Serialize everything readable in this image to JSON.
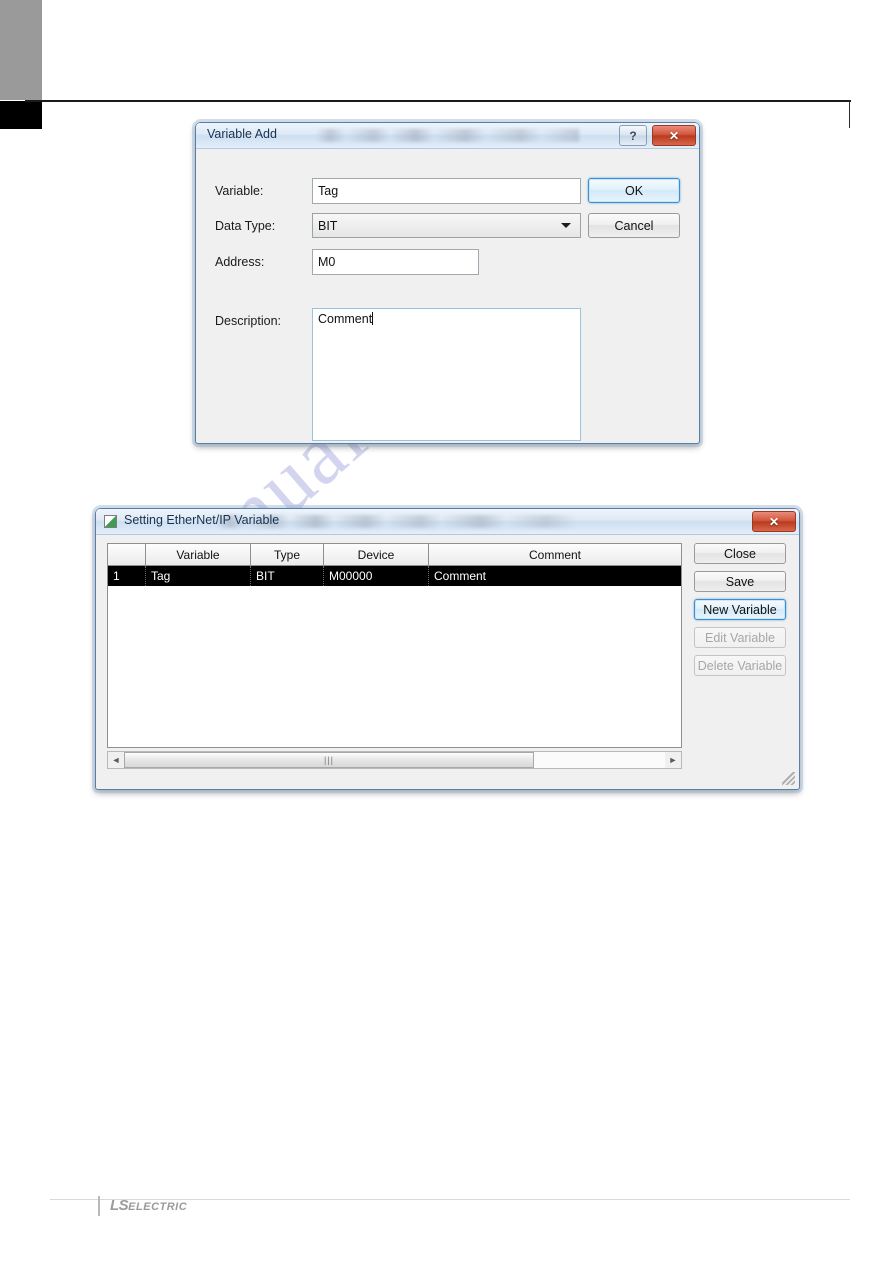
{
  "page": {
    "footer_logo_main": "LS",
    "footer_logo_sub": "ELECTRIC",
    "watermark": "manualshive.com"
  },
  "variable_add_dialog": {
    "title": "Variable Add",
    "help_button": "?",
    "close_button": "✕",
    "fields": {
      "variable_label": "Variable:",
      "variable_value": "Tag",
      "data_type_label": "Data Type:",
      "data_type_value": "BIT",
      "address_label": "Address:",
      "address_value": "M0",
      "description_label": "Description:",
      "description_value": "Comment"
    },
    "buttons": {
      "ok": "OK",
      "cancel": "Cancel"
    }
  },
  "setting_dialog": {
    "title": "Setting EtherNet/IP Variable",
    "close_button": "✕",
    "grid": {
      "columns": [
        "",
        "Variable",
        "Type",
        "Device",
        "Comment"
      ],
      "rows": [
        {
          "num": "1",
          "variable": "Tag",
          "type": "BIT",
          "device": "M00000",
          "comment": "Comment"
        }
      ]
    },
    "scrollbar": {
      "left_arrow": "◄",
      "right_arrow": "►",
      "grip": "|||"
    },
    "buttons": {
      "close": "Close",
      "save": "Save",
      "new_variable": "New Variable",
      "edit_variable": "Edit Variable",
      "delete_variable": "Delete Variable"
    }
  }
}
